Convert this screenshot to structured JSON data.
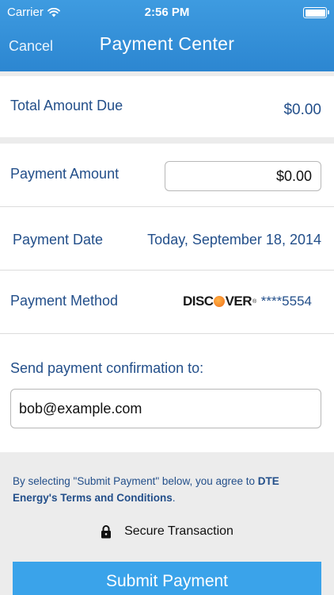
{
  "status_bar": {
    "carrier": "Carrier",
    "time": "2:56 PM",
    "wifi_icon": "wifi-icon",
    "battery_icon": "battery-icon"
  },
  "nav": {
    "cancel_label": "Cancel",
    "title": "Payment Center",
    "bar_color": "#2c86d1"
  },
  "total": {
    "label": "Total Amount Due",
    "value": "$0.00"
  },
  "payment_amount": {
    "label": "Payment Amount",
    "value": "$0.00"
  },
  "payment_date": {
    "label": "Payment Date",
    "value": "Today, September 18, 2014"
  },
  "payment_method": {
    "label": "Payment Method",
    "card_brand": "DISCOVER",
    "card_number": "****5554"
  },
  "confirmation": {
    "label": "Send payment confirmation to:",
    "email": "bob@example.com"
  },
  "terms": {
    "text_before": "By selecting \"Submit Payment\" below, you agree to ",
    "link_label": "DTE Energy's Terms and Conditions",
    "text_after": "."
  },
  "secure": {
    "label": "Secure Transaction",
    "icon": "lock-icon"
  },
  "submit": {
    "label": "Submit Payment",
    "color": "#3aa3ea"
  },
  "colors": {
    "label_text": "#234f8a",
    "background_gray": "#ececec"
  }
}
